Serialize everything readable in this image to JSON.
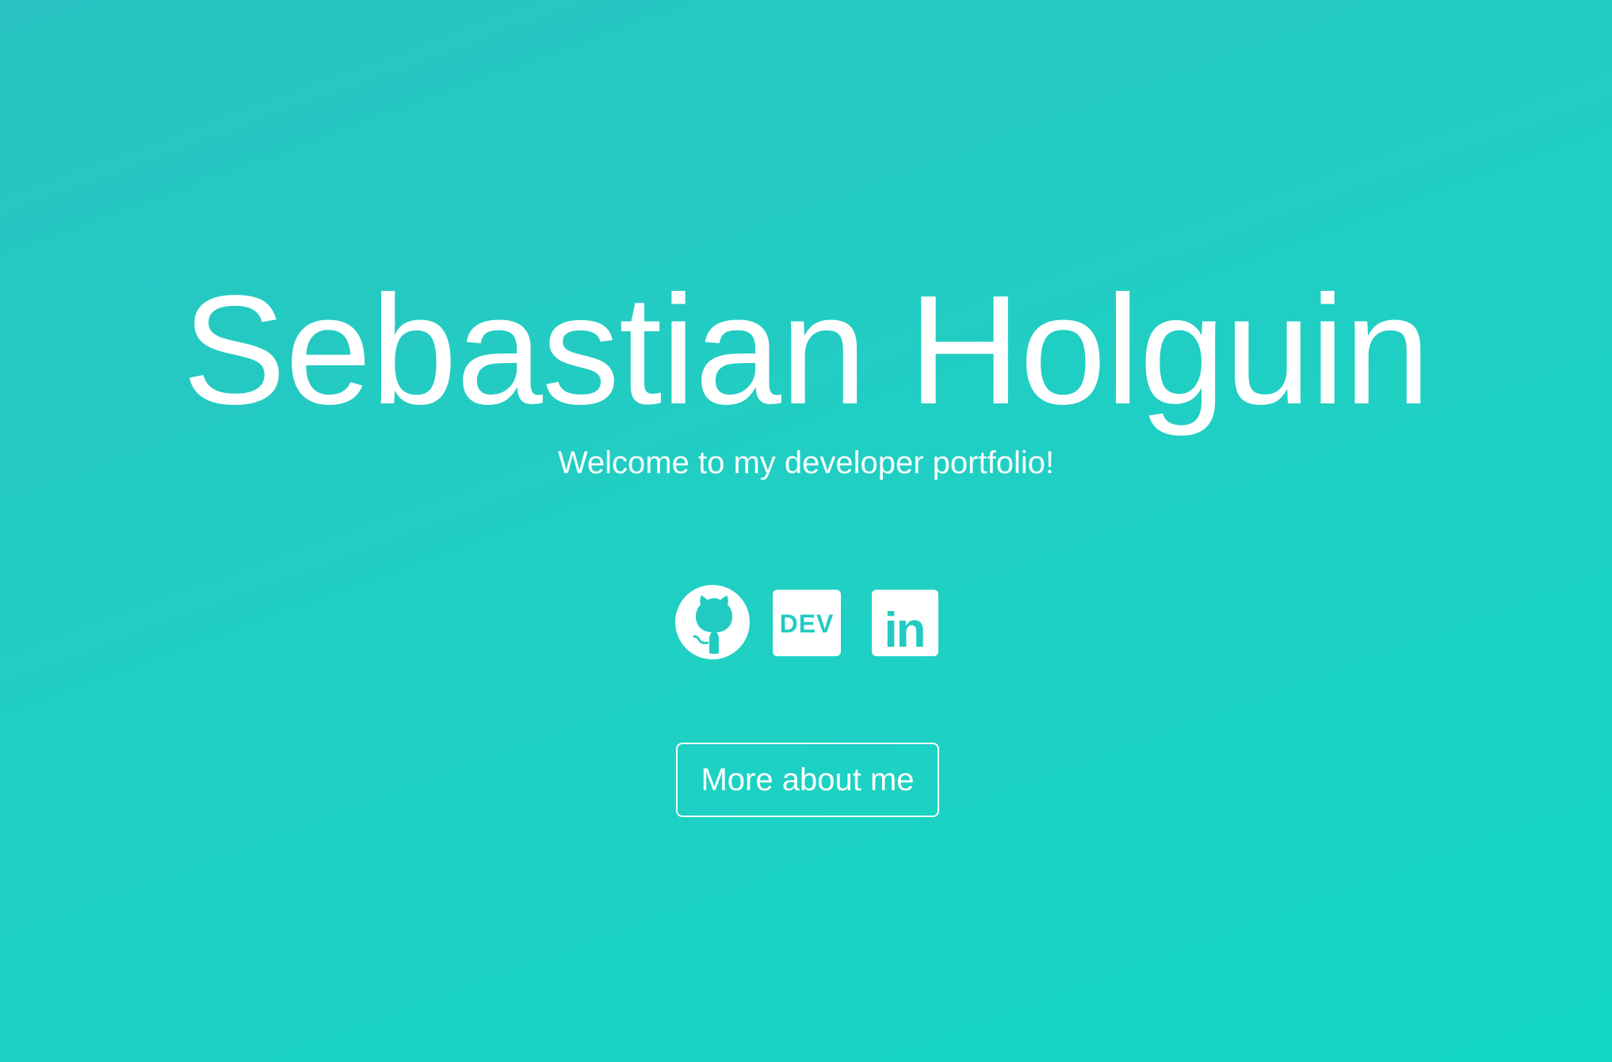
{
  "hero": {
    "title": "Sebastian Holguin",
    "subtitle": "Welcome to my developer portfolio!",
    "cta_label": "More about me"
  },
  "socials": [
    {
      "name": "GitHub",
      "icon": "github-icon"
    },
    {
      "name": "DEV",
      "icon": "dev-icon",
      "badge_text": "DEV"
    },
    {
      "name": "LinkedIn",
      "icon": "linkedin-icon",
      "badge_text": "in"
    }
  ],
  "colors": {
    "background_start": "#29c4c1",
    "background_end": "#12d6c2",
    "foreground": "#ffffff"
  }
}
